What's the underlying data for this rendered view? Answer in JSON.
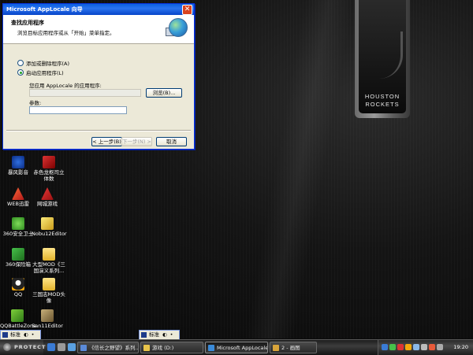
{
  "desktop": {
    "banner_line1": "HOUSTON",
    "banner_line2": "ROCKETS",
    "icons": [
      {
        "label": "暴风影音"
      },
      {
        "label": "赤色龙枢司立体数"
      },
      {
        "label": "WEB迅雷"
      },
      {
        "label": "网城游戏"
      },
      {
        "label": "360安全卫士"
      },
      {
        "label": "Nobu12Editor"
      },
      {
        "label": "360保险箱"
      },
      {
        "label": "大型MOD《三国演义系列..."
      },
      {
        "label": "QQ"
      },
      {
        "label": "三国志MOD头像"
      },
      {
        "label": "QQBattleZone"
      },
      {
        "label": "San11Editor"
      }
    ]
  },
  "dialog": {
    "title": "Microsoft AppLocale 向导",
    "close": "✕",
    "header_title": "查找应用程序",
    "header_subtitle": "浏览目标应用程序或从「开始」菜单指定。",
    "radio_add_remove": "添加或删除程序(A)",
    "radio_launch": "启动应用程序(L)",
    "app_label": "您应用 AppLocale 的应用程序:",
    "app_value": "",
    "browse": "浏览(B)...",
    "params_label": "参数:",
    "params_value": "",
    "back": "< 上一步(B)",
    "next": "下一步(N) >",
    "cancel": "取消"
  },
  "ime": {
    "label": "标准"
  },
  "taskbar": {
    "start_label": "PROTECT",
    "tasks": [
      {
        "label": "《信长之野望》系列..."
      },
      {
        "label": "游戏 (D:)"
      },
      {
        "label": "Microsoft AppLocale ..."
      },
      {
        "label": "2 - 画图"
      }
    ],
    "clock": "19:20"
  }
}
